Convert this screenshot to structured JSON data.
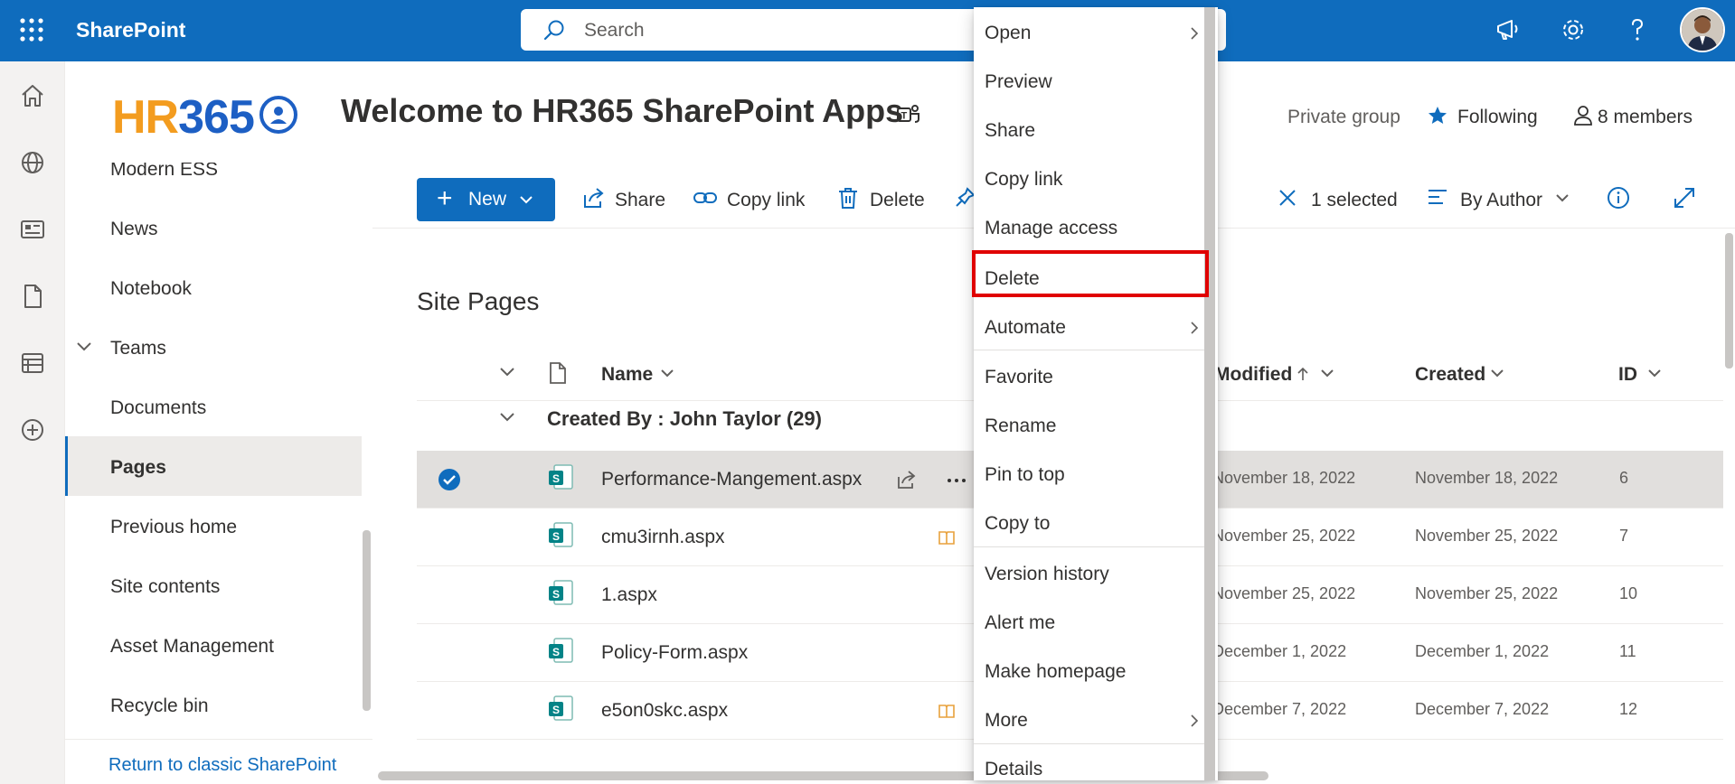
{
  "suitebar": {
    "brand": "SharePoint",
    "search_placeholder": "Search"
  },
  "header": {
    "logo_hr": "HR",
    "logo_num": "365",
    "site_title": "Welcome to HR365 SharePoint Apps",
    "privacy": "Private group",
    "following": "Following",
    "members": "8 members"
  },
  "leftnav": {
    "items": [
      "Modern ESS",
      "News",
      "Notebook",
      "Teams",
      "Documents",
      "Pages",
      "Previous home",
      "Site contents",
      "Asset Management",
      "Recycle bin"
    ],
    "selected": "Pages",
    "return_link": "Return to classic SharePoint"
  },
  "commandbar": {
    "new": "New",
    "share": "Share",
    "copy_link": "Copy link",
    "delete": "Delete",
    "selected": "1 selected",
    "view": "By Author"
  },
  "library": {
    "title": "Site Pages",
    "columns": {
      "name": "Name",
      "modified": "Modified",
      "created": "Created",
      "id": "ID"
    },
    "group": "Created By : John Taylor (29)",
    "rows": [
      {
        "name": "Performance-Mangement.aspx",
        "modified": "November 18, 2022",
        "created": "November 18, 2022",
        "id": "6",
        "selected": true
      },
      {
        "name": "cmu3irnh.aspx",
        "modified": "November 25, 2022",
        "created": "November 25, 2022",
        "id": "7",
        "selected": false
      },
      {
        "name": "1.aspx",
        "modified": "November 25, 2022",
        "created": "November 25, 2022",
        "id": "10",
        "selected": false
      },
      {
        "name": "Policy-Form.aspx",
        "modified": "December 1, 2022",
        "created": "December 1, 2022",
        "id": "11",
        "selected": false
      },
      {
        "name": "e5on0skc.aspx",
        "modified": "December 7, 2022",
        "created": "December 7, 2022",
        "id": "12",
        "selected": false
      }
    ]
  },
  "context_menu": {
    "items": [
      "Open",
      "Preview",
      "Share",
      "Copy link",
      "Manage access",
      "Delete",
      "Automate",
      "Favorite",
      "Rename",
      "Pin to top",
      "Copy to",
      "Version history",
      "Alert me",
      "Make homepage",
      "More",
      "Details"
    ],
    "highlighted": "Delete"
  },
  "colors": {
    "brand": "#0f6cbd",
    "highlight": "#e00000",
    "logo_orange": "#f39c1f",
    "logo_blue": "#1d5fc4"
  }
}
